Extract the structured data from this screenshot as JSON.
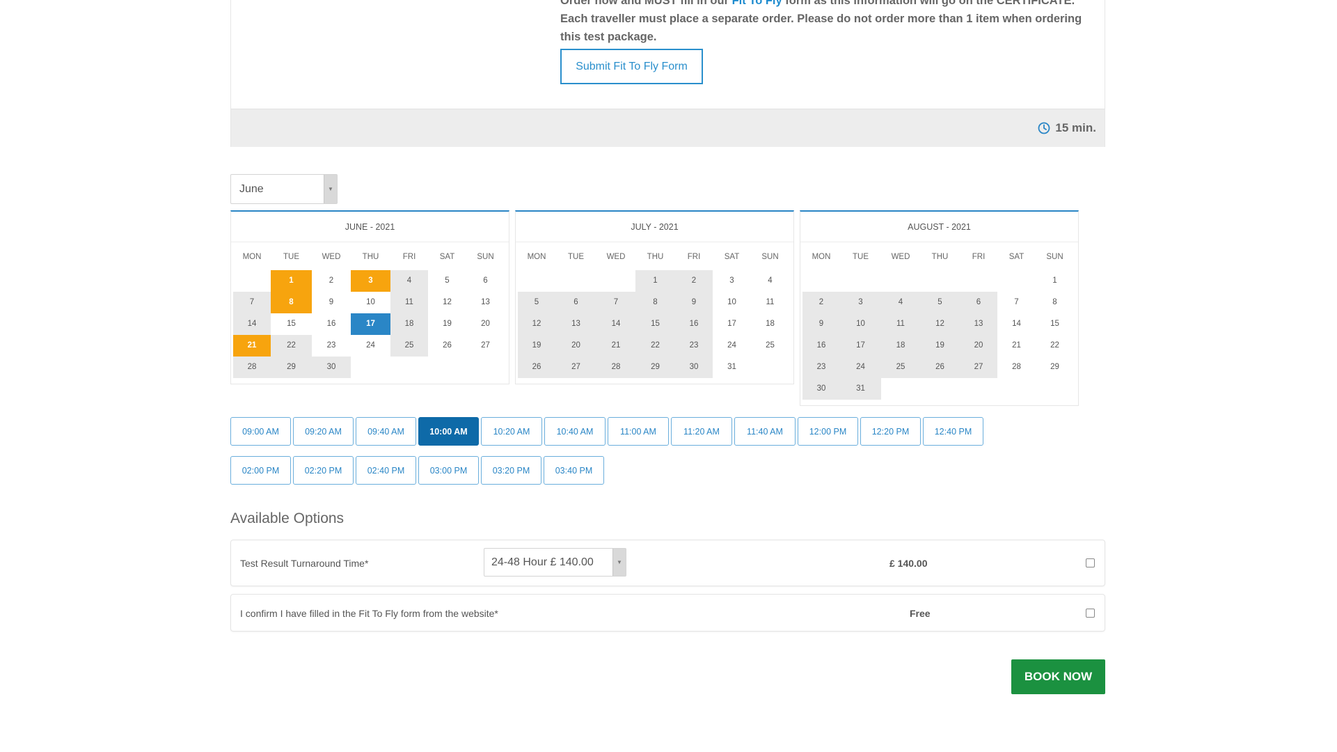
{
  "service": {
    "text_before_link": "Order now and MUST fill in our ",
    "link_text": "Fit To Fly",
    "text_after_link": " form as this information will go on the CERTIFICATE. Each traveller must place a separate order. Please do not order more than 1 item when ordering this test package.",
    "submit_button": "Submit Fit To Fly Form",
    "duration": "15 min.",
    "duration_icon": "clock-icon"
  },
  "month_select": {
    "value": "June"
  },
  "calendars": [
    {
      "title": "JUNE - 2021",
      "weekdays": [
        "MON",
        "TUE",
        "WED",
        "THU",
        "FRI",
        "SAT",
        "SUN"
      ],
      "offset": 1,
      "days": 30,
      "available_days": [
        1,
        3,
        8,
        21
      ],
      "selected_day": 17,
      "gray_days": [
        4,
        7,
        11,
        14,
        18,
        22,
        25,
        28,
        29,
        30
      ]
    },
    {
      "title": "JULY - 2021",
      "weekdays": [
        "MON",
        "TUE",
        "WED",
        "THU",
        "FRI",
        "SAT",
        "SUN"
      ],
      "offset": 3,
      "days": 31,
      "available_days": [],
      "selected_day": null,
      "gray_days": [
        1,
        2,
        5,
        6,
        7,
        8,
        9,
        12,
        13,
        14,
        15,
        16,
        19,
        20,
        21,
        22,
        23,
        26,
        27,
        28,
        29,
        30
      ]
    },
    {
      "title": "AUGUST - 2021",
      "weekdays": [
        "MON",
        "TUE",
        "WED",
        "THU",
        "FRI",
        "SAT",
        "SUN"
      ],
      "offset": 6,
      "days": 31,
      "available_days": [],
      "selected_day": null,
      "gray_days": [
        2,
        3,
        4,
        5,
        6,
        9,
        10,
        11,
        12,
        13,
        16,
        17,
        18,
        19,
        20,
        23,
        24,
        25,
        26,
        27,
        30,
        31
      ]
    }
  ],
  "time_slots": {
    "row1": [
      "09:00 AM",
      "09:20 AM",
      "09:40 AM",
      "10:00 AM",
      "10:20 AM",
      "10:40 AM",
      "11:00 AM",
      "11:20 AM",
      "11:40 AM",
      "12:00 PM",
      "12:20 PM",
      "12:40 PM"
    ],
    "row2": [
      "02:00 PM",
      "02:20 PM",
      "02:40 PM",
      "03:00 PM",
      "03:20 PM",
      "03:40 PM"
    ],
    "selected": "10:00 AM"
  },
  "options": {
    "title": "Available Options",
    "turnaround": {
      "label": "Test Result Turnaround Time*",
      "select_value": "24-48 Hour £ 140.00",
      "price": "£ 140.00"
    },
    "confirm": {
      "label": "I confirm I have filled in the Fit To Fly form from the website*",
      "price": "Free"
    }
  },
  "book_now": "BOOK NOW",
  "colors": {
    "accent_blue": "#2a86c6",
    "available_orange": "#f7a40e",
    "book_green": "#1b9140"
  }
}
